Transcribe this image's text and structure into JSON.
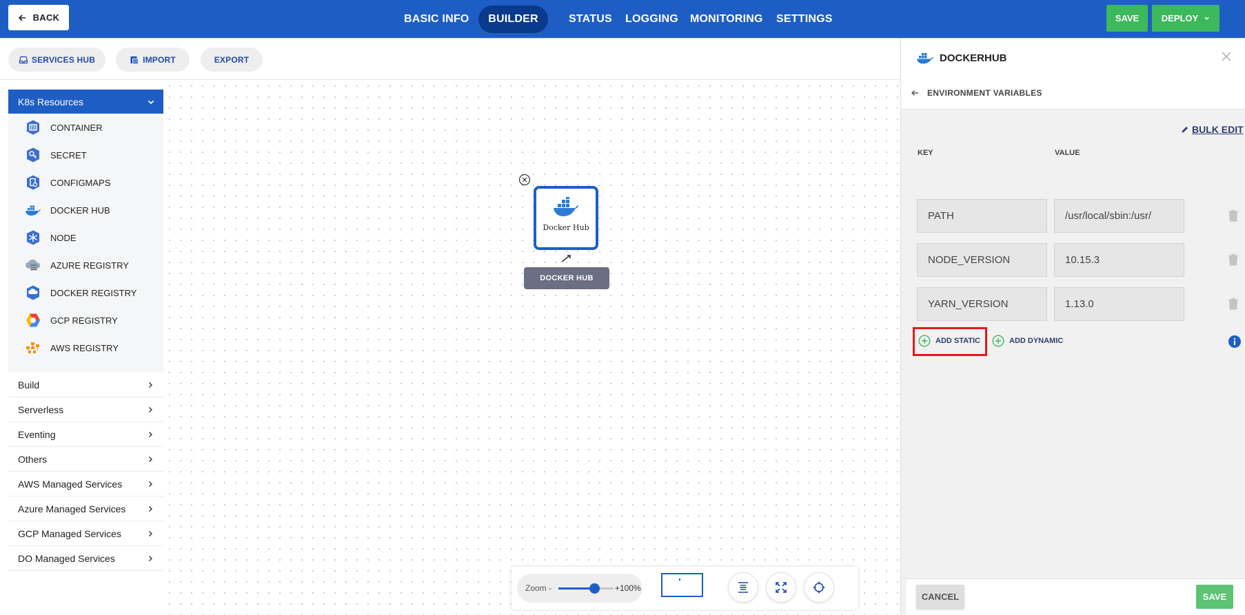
{
  "topbar": {
    "back_label": "BACK",
    "nav": [
      "BASIC INFO",
      "BUILDER",
      "STATUS",
      "LOGGING",
      "MONITORING",
      "SETTINGS"
    ],
    "active_nav": "BUILDER",
    "save_label": "SAVE",
    "deploy_label": "DEPLOY"
  },
  "toolbar": {
    "services_hub": "SERVICES HUB",
    "import": "IMPORT",
    "export": "EXPORT"
  },
  "sidebar": {
    "k8s_header": "K8s Resources",
    "k8s_items": [
      {
        "label": "CONTAINER",
        "icon": "container-icon"
      },
      {
        "label": "SECRET",
        "icon": "secret-icon"
      },
      {
        "label": "CONFIGMAPS",
        "icon": "configmap-icon"
      },
      {
        "label": "DOCKER HUB",
        "icon": "docker-icon"
      },
      {
        "label": "NODE",
        "icon": "node-icon"
      },
      {
        "label": "AZURE REGISTRY",
        "icon": "azure-registry-icon"
      },
      {
        "label": "DOCKER REGISTRY",
        "icon": "docker-registry-icon"
      },
      {
        "label": "GCP REGISTRY",
        "icon": "gcp-registry-icon"
      },
      {
        "label": "AWS REGISTRY",
        "icon": "aws-registry-icon"
      }
    ],
    "categories": [
      "Build",
      "Serverless",
      "Eventing",
      "Others",
      "AWS Managed Services",
      "Azure Managed Services",
      "GCP Managed Services",
      "DO Managed Services"
    ]
  },
  "canvas": {
    "node_title": "Docker Hub",
    "node_label": "DOCKER HUB"
  },
  "zoom": {
    "label": "Zoom",
    "minus": "-",
    "value_text": "+100%",
    "level_fraction": 0.65
  },
  "panel": {
    "title": "DOCKERHUB",
    "section": "ENVIRONMENT VARIABLES",
    "bulk_edit": "BULK EDIT",
    "key_header": "KEY",
    "value_header": "VALUE",
    "rows": [
      {
        "key": "PATH",
        "value": "/usr/local/sbin:/usr/"
      },
      {
        "key": "NODE_VERSION",
        "value": "10.15.3"
      },
      {
        "key": "YARN_VERSION",
        "value": "1.13.0"
      }
    ],
    "add_static": "ADD STATIC",
    "add_dynamic": "ADD DYNAMIC",
    "cancel": "CANCEL",
    "save": "SAVE"
  },
  "colors": {
    "brand_blue": "#1e5ec4",
    "active_nav": "#0a3a8c",
    "green": "#3cb95a",
    "highlight": "#e3191c"
  }
}
